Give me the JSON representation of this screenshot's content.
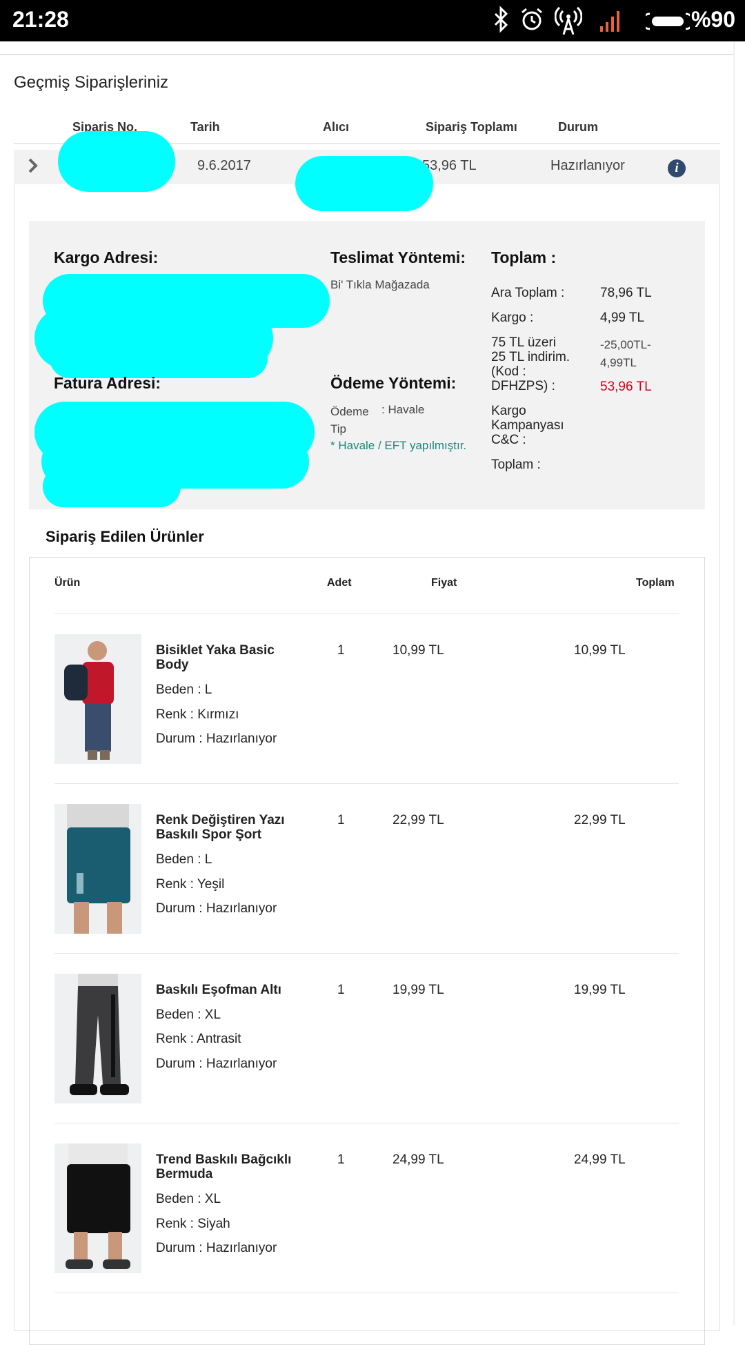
{
  "status_bar": {
    "time": "21:28",
    "battery": "%90"
  },
  "page_title": "Geçmiş Siparişleriniz",
  "orders_table": {
    "headers": [
      "Sipariş No.",
      "Tarih",
      "Alıcı",
      "Sipariş Toplamı",
      "Durum"
    ],
    "row": {
      "date": "9.6.2017",
      "total": "53,96 TL",
      "status": "Hazırlanıyor"
    }
  },
  "details": {
    "cargo_address_label": "Kargo Adresi:",
    "invoice_address_label": "Fatura Adresi:",
    "delivery_label": "Teslimat Yöntemi:",
    "delivery_value": "Bi' Tıkla Mağazada",
    "payment_label": "Ödeme Yöntemi:",
    "payment_type_label": "Ödeme Tip",
    "payment_type_value": ": Havale",
    "payment_note": "* Havale / EFT yapılmıştır.",
    "total_label": "Toplam :",
    "summary": [
      {
        "label": "Ara Toplam :",
        "value": "78,96 TL"
      },
      {
        "label": "Kargo :",
        "value": "4,99 TL"
      },
      {
        "label": "75 TL üzeri 25 TL indirim.(Kod : DFHZPS) :",
        "value": "-25,00TL-4,99TL"
      },
      {
        "label": "Kargo Kampanyası C&C :",
        "value": "53,96 TL"
      },
      {
        "label": "Toplam :",
        "value": ""
      }
    ]
  },
  "products": {
    "title": "Sipariş Edilen Ürünler",
    "headers": [
      "Ürün",
      "Adet",
      "Fiyat",
      "Toplam"
    ],
    "items": [
      {
        "name": "Bisiklet Yaka Basic Body",
        "size": "Beden : L",
        "color": "Renk : Kırmızı",
        "state": "Durum : Hazırlanıyor",
        "qty": "1",
        "price": "10,99 TL",
        "total": "10,99 TL"
      },
      {
        "name": "Renk Değiştiren Yazı Baskılı Spor Şort",
        "size": "Beden : L",
        "color": "Renk : Yeşil",
        "state": "Durum : Hazırlanıyor",
        "qty": "1",
        "price": "22,99 TL",
        "total": "22,99 TL"
      },
      {
        "name": "Baskılı Eşofman Altı",
        "size": "Beden : XL",
        "color": "Renk : Antrasit",
        "state": "Durum : Hazırlanıyor",
        "qty": "1",
        "price": "19,99 TL",
        "total": "19,99 TL"
      },
      {
        "name": "Trend Baskılı Bağcıklı Bermuda",
        "size": "Beden : XL",
        "color": "Renk : Siyah",
        "state": "Durum : Hazırlanıyor",
        "qty": "1",
        "price": "24,99 TL",
        "total": "24,99 TL"
      }
    ]
  },
  "colors": {
    "accent_red": "#d0021b",
    "note_green": "#1a8a78",
    "redaction": "#00ffff"
  }
}
